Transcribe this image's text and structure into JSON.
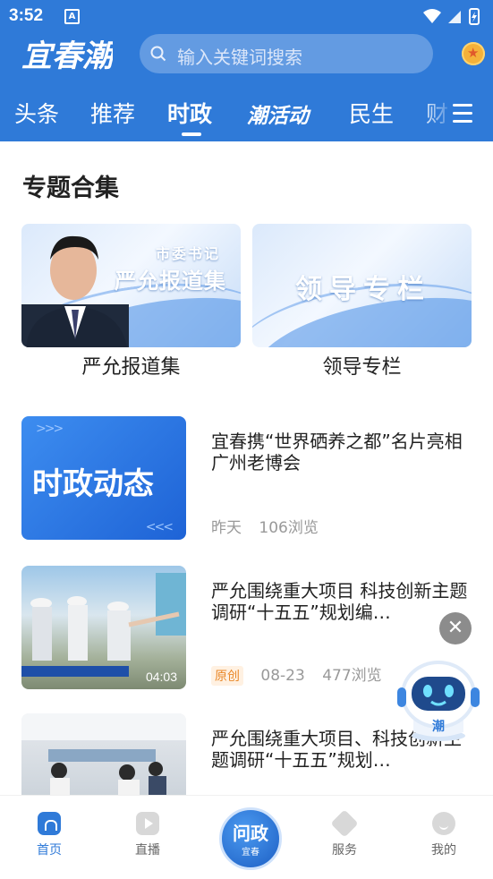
{
  "status": {
    "time": "3:52",
    "notif_letter": "A"
  },
  "header": {
    "logo_text": "宜春潮",
    "search_placeholder": "输入关键词搜索"
  },
  "tabs": [
    {
      "label": "头条"
    },
    {
      "label": "推荐"
    },
    {
      "label": "时政",
      "active": true
    },
    {
      "label": "潮活动"
    },
    {
      "label": "民生"
    },
    {
      "label": "财"
    }
  ],
  "section": {
    "title": "专题合集"
  },
  "topics": [
    {
      "label": "严允报道集",
      "card_small": "市委书记",
      "card_big": "严允报道集"
    },
    {
      "label": "领导专栏",
      "card_big": "领导专栏"
    }
  ],
  "news": [
    {
      "thumb_text": "时政动态",
      "title": "宜春携“世界硒养之都”名片亮相广州老博会",
      "date": "昨天",
      "views": "106浏览"
    },
    {
      "title": "严允围绕重大项目  科技创新主题调研“十五五”规划编…",
      "badge": "原创",
      "date": "08-23",
      "views": "477浏览",
      "duration": "04:03"
    },
    {
      "title": "严允围绕重大项目、科技创新主题调研“十五五”规划…"
    }
  ],
  "robot": {
    "label": "潮"
  },
  "bottom_nav": {
    "home": "首页",
    "live": "直播",
    "center_main": "问政",
    "center_sub": "宜春",
    "service": "服务",
    "mine": "我的"
  },
  "colors": {
    "brand_blue": "#2f7ad8",
    "badge_orange": "#e9892a"
  }
}
